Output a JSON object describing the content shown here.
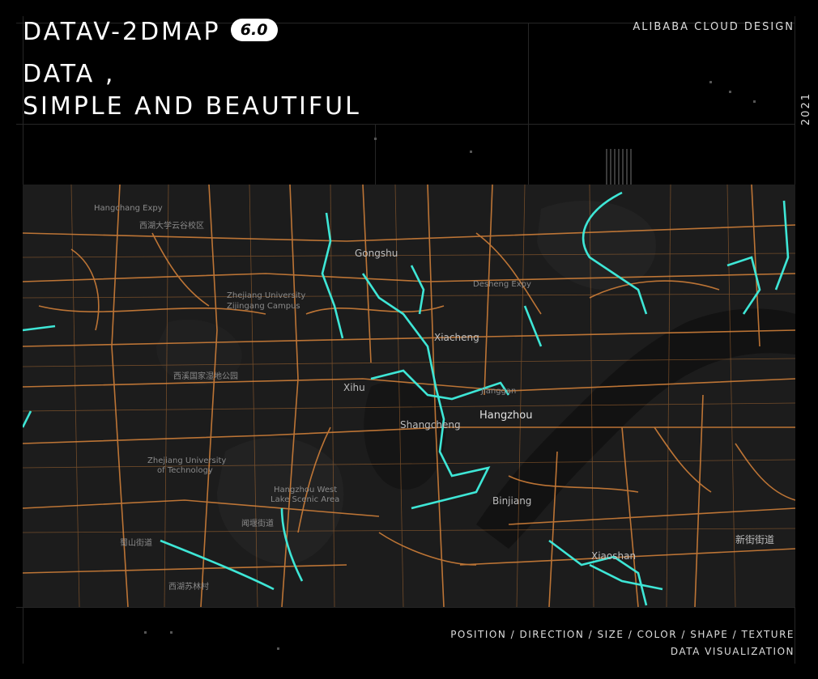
{
  "header": {
    "title_main": "DATAV-2DMAP",
    "version_badge": "6.0",
    "tagline_line1": "DATA ,",
    "tagline_line2": "SIMPLE AND BEAUTIFUL",
    "brand": "ALIBABA CLOUD DESIGN",
    "year": "2021"
  },
  "footer": {
    "line1": "POSITION / DIRECTION / SIZE / COLOR / SHAPE / TEXTURE",
    "line2": "DATA VISUALIZATION"
  },
  "map": {
    "colors": {
      "background": "#1c1c1c",
      "road": "#d9843a",
      "highlight": "#3ee6d6",
      "water": "#121212",
      "green": "#232323"
    },
    "labels": {
      "gongshu": "Gongshu",
      "xiacheng": "Xiacheng",
      "xihu": "Xihu",
      "shangcheng": "Shangcheng",
      "hangzhou": "Hangzhou",
      "binjiang": "Binjiang",
      "xiaoshan": "Xiaoshan",
      "jianggan": "Jianggan",
      "zju": "Zhejiang University",
      "zju_campus": "Zijingang Campus",
      "zjut_1": "Zhejiang University",
      "zjut_2": "of Technology",
      "west_lake_1": "Hangzhou West",
      "west_lake_2": "Lake Scenic Area",
      "xixi": "西溪国家湿地公园",
      "xijiao": "西湖大学云谷校区",
      "dengcheng": "Desheng Expy",
      "hangchang": "Hangchang Expy",
      "xinjie": "新街街道",
      "shupu": "蜀山街道",
      "wenyan": "闻堰街道",
      "xianghu": "西湖苏林村"
    }
  }
}
